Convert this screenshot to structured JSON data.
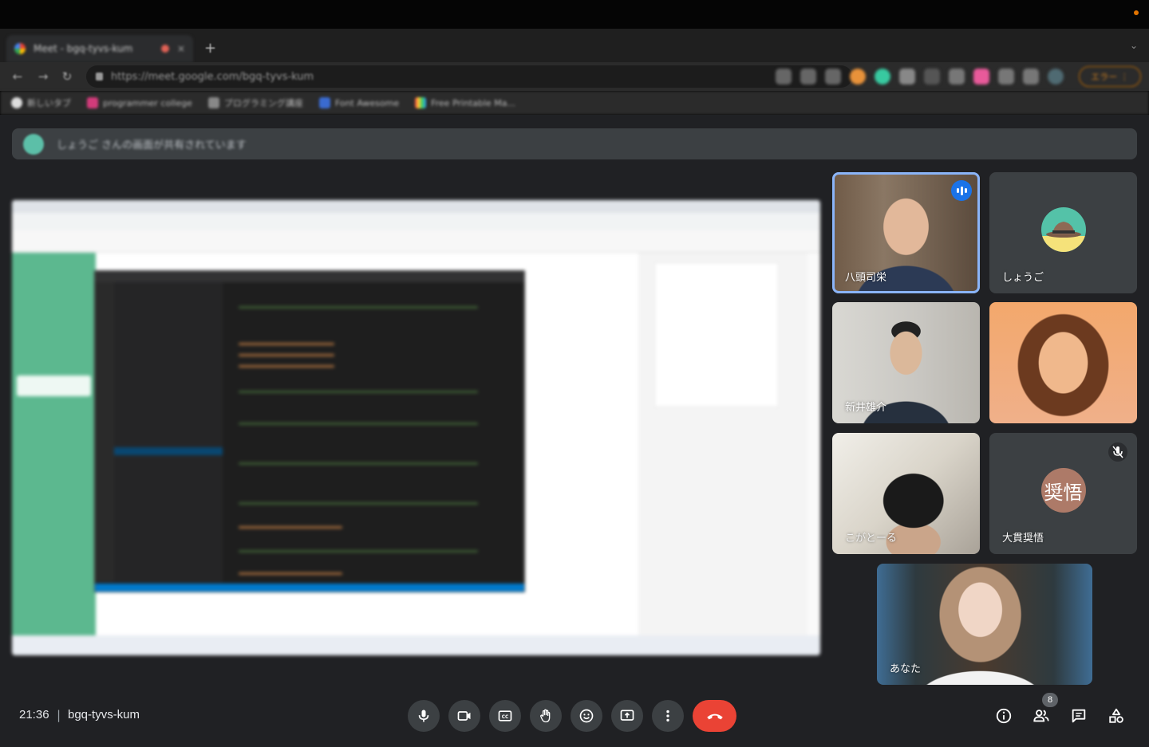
{
  "browser": {
    "tab_title": "Meet - bgq-tyvs-kum",
    "tab_close": "×",
    "new_tab": "+",
    "url": "https://meet.google.com/bgq-tyvs-kum",
    "update_label": "エラー",
    "bookmarks": [
      "新しいタブ",
      "programmer college",
      "プログラミング講座",
      "Font Awesome",
      "Free Printable Ma..."
    ]
  },
  "banner": {
    "text": "しょうご さんの画面が共有されています"
  },
  "participants": [
    {
      "name": "八頭司栄",
      "speaking": true,
      "type": "video"
    },
    {
      "name": "しょうご",
      "type": "avatar"
    },
    {
      "name": "新井雄介",
      "type": "video"
    },
    {
      "name": "",
      "type": "video"
    },
    {
      "name": "こがとーる",
      "type": "video"
    },
    {
      "name": "大貫奨悟",
      "type": "letter",
      "initials": "奨悟",
      "muted": true
    },
    {
      "name": "あなた",
      "type": "video"
    }
  ],
  "bottombar": {
    "time": "21:36",
    "separator": "|",
    "meeting_code": "bgq-tyvs-kum",
    "people_count": "8"
  },
  "colors": {
    "meet_bg": "#202124",
    "control_bg": "#3c4043",
    "hangup": "#ea4335",
    "accent": "#8ab4f8",
    "speaking": "#1a73e8"
  }
}
